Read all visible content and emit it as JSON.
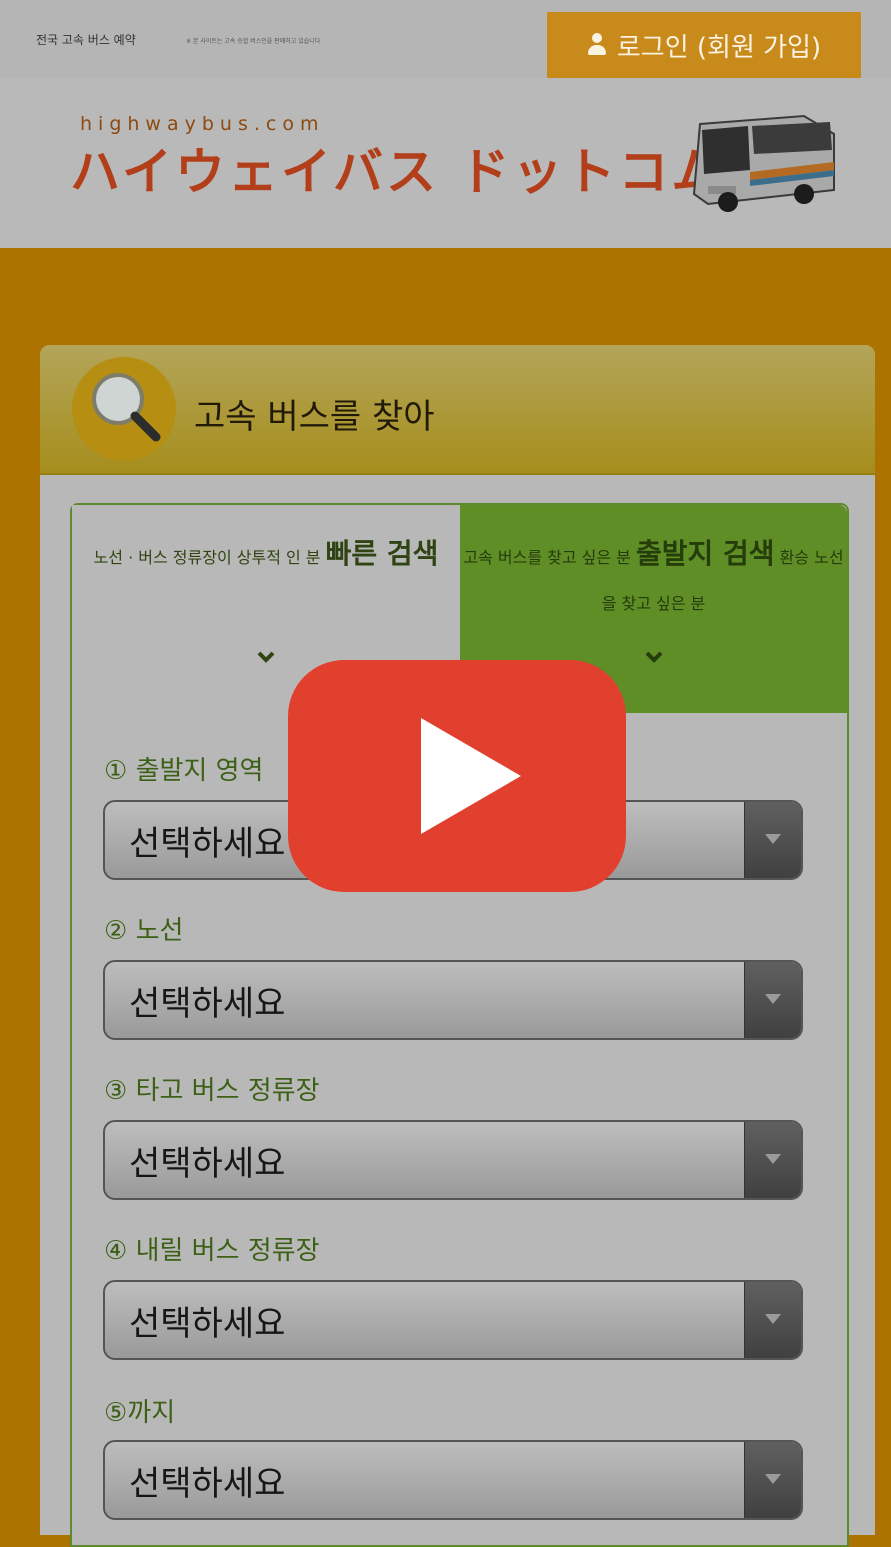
{
  "topbar": {
    "site_label": "전국 고속 버스 예약",
    "site_note": "※ 본 사이트는 고속 승합 버스인을 판매하고 있습니다",
    "login_label": "로그인 (회원 가입)",
    "login_icon": "user-icon"
  },
  "logo": {
    "sub": "highwaybus.com",
    "main": "ハイウェイバス ドットコム"
  },
  "search": {
    "title": "고속 버스를 찾아",
    "icon": "magnifier-icon"
  },
  "tabs": [
    {
      "text_before": "노선 · 버스 정류장이 상투적 인 분 ",
      "big": "빠른 검색",
      "text_after": ""
    },
    {
      "text_before": "고속 버스를 찾고 싶은 분 ",
      "big": "출발지 검색",
      "text_after": " 환승 노선을 찾고 싶은 분"
    }
  ],
  "fields": [
    {
      "label": "① 출발지 영역",
      "value": "선택하세요"
    },
    {
      "label": "② 노선",
      "value": "선택하세요"
    },
    {
      "label": "③ 타고 버스 정류장",
      "value": "선택하세요"
    },
    {
      "label": "④ 내릴 버스 정류장",
      "value": "선택하세요"
    },
    {
      "label": "⑤까지",
      "value": "선택하세요"
    }
  ],
  "overlay": {
    "icon": "play-icon"
  },
  "colors": {
    "page_background": "#ad7300",
    "login_button": "#c98a1c",
    "logo_text": "#b23f1a",
    "panel_header": "#a68e1c",
    "active_tab": "#5f8d26",
    "play_button": "#e2402f"
  }
}
